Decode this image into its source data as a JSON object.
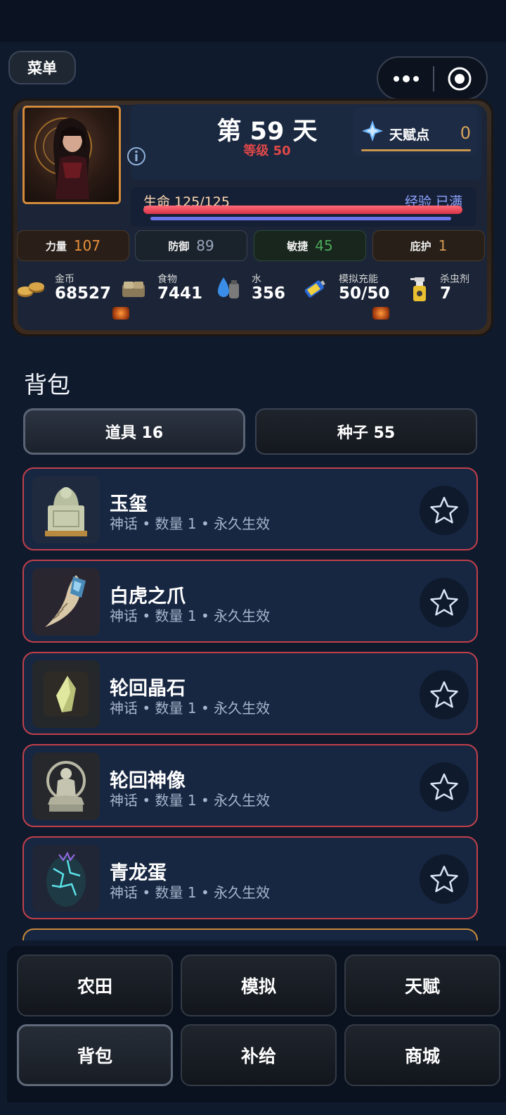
{
  "header": {
    "menu_label": "菜单"
  },
  "status": {
    "day_title": "第 59 天",
    "level": "等级 50",
    "talent_label": "天赋点",
    "talent_value": "0",
    "hp_label": "生命 125/125",
    "hp_fraction": 1.0,
    "xp_label": "经验 已满",
    "xp_fraction": 1.0,
    "stats": [
      {
        "label": "力量",
        "value": "107",
        "color": "#e8913c"
      },
      {
        "label": "防御",
        "value": "89",
        "color": "#9aa8bc"
      },
      {
        "label": "敏捷",
        "value": "45",
        "color": "#4caa5a"
      },
      {
        "label": "庇护",
        "value": "1",
        "color": "#d49a52"
      }
    ],
    "resources": [
      {
        "name": "金币",
        "value": "68527",
        "icon": "coins-icon"
      },
      {
        "name": "食物",
        "value": "7441",
        "icon": "food-crate-icon"
      },
      {
        "name": "水",
        "value": "356",
        "icon": "water-drop-icon"
      },
      {
        "name": "模拟充能",
        "value": "50/50",
        "icon": "battery-icon"
      },
      {
        "name": "杀虫剂",
        "value": "7",
        "icon": "spray-bottle-icon"
      }
    ]
  },
  "backpack": {
    "title": "背包",
    "tabs": [
      {
        "label": "道具 16",
        "active": true
      },
      {
        "label": "种子 55",
        "active": false
      }
    ],
    "items": [
      {
        "name": "玉玺",
        "meta": "神话 • 数量 1 • 永久生效",
        "icon": "jade-seal-icon"
      },
      {
        "name": "白虎之爪",
        "meta": "神话 • 数量 1 • 永久生效",
        "icon": "tiger-claw-icon"
      },
      {
        "name": "轮回晶石",
        "meta": "神话 • 数量 1 • 永久生效",
        "icon": "crystal-icon"
      },
      {
        "name": "轮回神像",
        "meta": "神话 • 数量 1 • 永久生效",
        "icon": "statue-icon"
      },
      {
        "name": "青龙蛋",
        "meta": "神话 • 数量 1 • 永久生效",
        "icon": "dragon-egg-icon"
      }
    ]
  },
  "nav": {
    "buttons": [
      {
        "label": "农田",
        "active": false
      },
      {
        "label": "模拟",
        "active": false
      },
      {
        "label": "天赋",
        "active": false
      },
      {
        "label": "背包",
        "active": true
      },
      {
        "label": "补给",
        "active": false
      },
      {
        "label": "商城",
        "active": false
      }
    ]
  },
  "colors": {
    "rarity_border": "#c0404a",
    "accent_gold": "#d9a45a",
    "background": "#0f1a2d"
  }
}
